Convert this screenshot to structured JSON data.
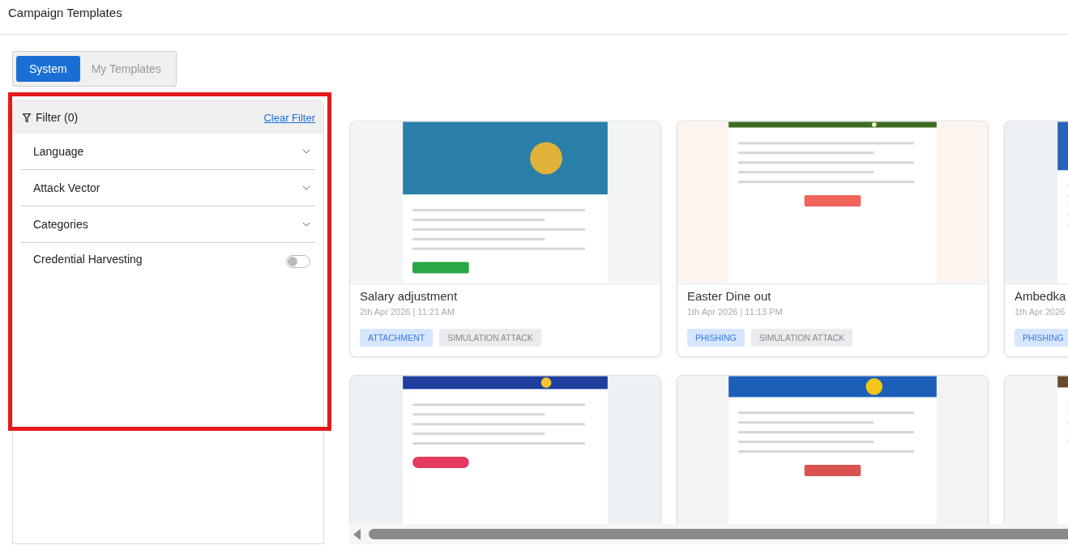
{
  "header": {
    "title": "Campaign Templates"
  },
  "template_tabs": [
    {
      "label": "System",
      "selected": true
    },
    {
      "label": "My Templates",
      "selected": false
    }
  ],
  "filter": {
    "title": "Filter (0)",
    "clear_link": "Clear Filter",
    "sections": [
      {
        "kind": "dropdown",
        "label": "Language",
        "expanded": false
      },
      {
        "kind": "dropdown",
        "label": "Attack Vector",
        "expanded": false
      },
      {
        "kind": "dropdown",
        "label": "Categories",
        "expanded": false
      },
      {
        "kind": "switch",
        "label": "Credential Harvesting",
        "on": false
      }
    ]
  },
  "templates": [
    {
      "title": "Salary adjustment",
      "date": "2th Apr 2026 | 11:21 AM",
      "tags": [
        {
          "kind": "vector",
          "label": "ATTACHMENT"
        },
        {
          "kind": "type",
          "label": "SIMULATION ATTACK"
        }
      ],
      "preview": {
        "kind": "picture"
      }
    },
    {
      "title": "Easter Dine out",
      "date": "1th Apr 2026 | 11:13 PM",
      "tags": [
        {
          "kind": "vector",
          "label": "PHISHING"
        },
        {
          "kind": "type",
          "label": "SIMULATION ATTACK"
        }
      ],
      "preview": {
        "kind": "picture"
      }
    },
    {
      "title": "Ambedka",
      "date": "1th Apr 2026",
      "tags": [
        {
          "kind": "vector",
          "label": "PHISHING"
        }
      ],
      "preview": {
        "kind": "picture"
      }
    },
    {
      "preview": {
        "kind": "picture"
      }
    },
    {
      "preview": {
        "kind": "picture"
      }
    },
    {
      "preview": {
        "kind": "picture"
      }
    }
  ]
}
